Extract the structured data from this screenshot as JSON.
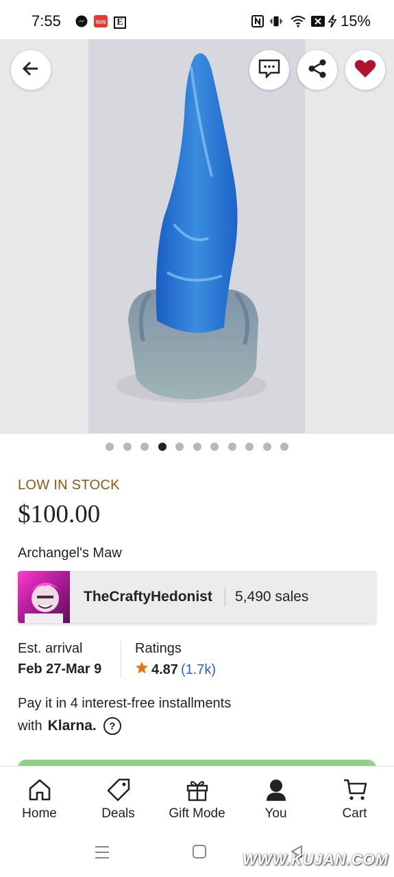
{
  "status_bar": {
    "time": "7:55",
    "battery": "15%",
    "icons": [
      "messenger-icon",
      "sos-icon",
      "etsy-e-icon",
      "nfc-icon",
      "vibrate-icon",
      "wifi-icon",
      "no-sim-icon",
      "charging-icon"
    ],
    "etsy_letter": "E",
    "sos_label": "SOS"
  },
  "hero": {
    "image_count": 11,
    "active_index": 3,
    "buttons": [
      "back-icon",
      "message-icon",
      "share-icon",
      "heart-icon"
    ]
  },
  "listing": {
    "stock_label": "LOW IN STOCK",
    "price": "$100.00",
    "title": "Archangel's Maw"
  },
  "shop": {
    "name": "TheCraftyHedonist",
    "sales": "5,490 sales"
  },
  "arrival": {
    "label": "Est. arrival",
    "value": "Feb 27-Mar 9"
  },
  "ratings": {
    "label": "Ratings",
    "value": "4.87",
    "count": "(1.7k)"
  },
  "klarna": {
    "line1": "Pay it in 4 interest-free installments",
    "line2": "with",
    "logo": "Klarna.",
    "help": "?"
  },
  "tabs": [
    {
      "label": "Home",
      "icon": "home-icon"
    },
    {
      "label": "Deals",
      "icon": "tag-icon"
    },
    {
      "label": "Gift Mode",
      "icon": "gift-icon"
    },
    {
      "label": "You",
      "icon": "person-icon"
    },
    {
      "label": "Cart",
      "icon": "cart-icon"
    }
  ],
  "watermark": "WWW.KUJAN.COM",
  "colors": {
    "accent_heart": "#b0142b",
    "stock_text": "#8a5a13",
    "rating_count": "#2f5cc8",
    "star": "#e07a10",
    "cta_green": "#8fd18a"
  }
}
